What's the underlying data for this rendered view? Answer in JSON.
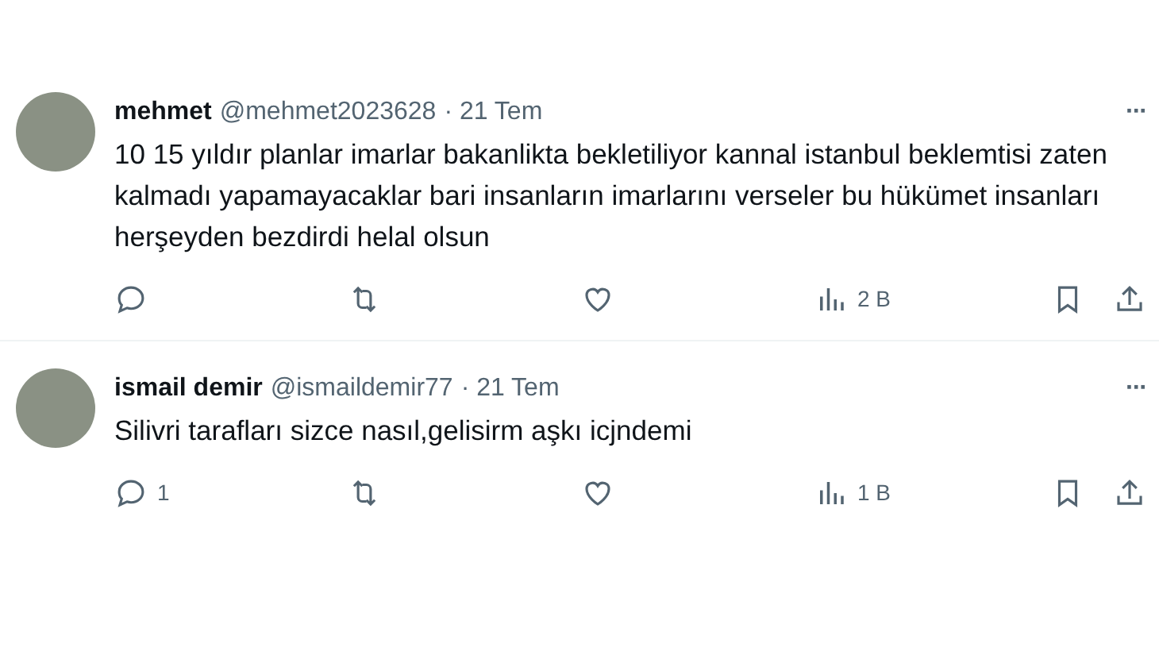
{
  "tweets": [
    {
      "name": "mehmet",
      "handle": "@mehmet2023628",
      "date": "· 21 Tem",
      "more": "···",
      "text": "10 15 yıldır planlar imarlar bakanlikta bekletiliyor kannal istanbul beklemtisi zaten kalmadı yapamayacaklar bari insanların imarlarını verseler bu hükümet insanları herşeyden bezdirdi helal olsun",
      "views": "2 B"
    },
    {
      "name": "ismail demir",
      "handle": "@ismaildemir77",
      "date": "· 21 Tem",
      "more": "···",
      "text": "Silivri tarafları sizce nasıl,gelisirm aşkı icjndemi",
      "replies": "1",
      "views": "1 B"
    }
  ]
}
